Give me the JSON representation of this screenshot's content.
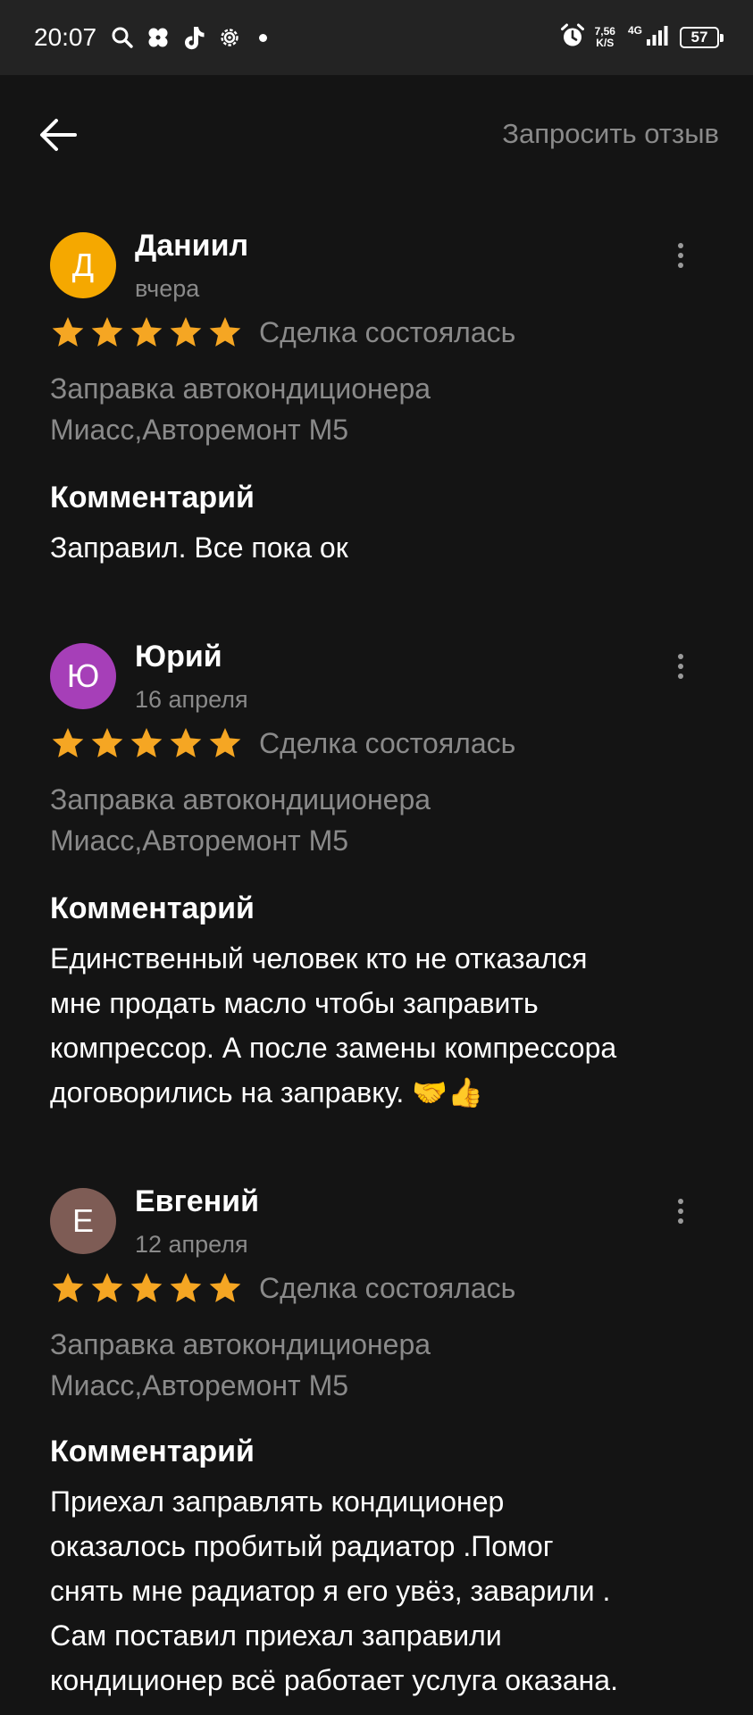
{
  "status_bar": {
    "time": "20:07",
    "left_icons": [
      "search-icon",
      "flower-app-icon",
      "tiktok-icon",
      "settings-gear-icon"
    ],
    "speed_value": "7,56",
    "speed_unit": "K/S",
    "network": "4G",
    "battery": "57"
  },
  "header": {
    "back_icon": "arrow-left-icon",
    "request_review": "Запросить отзыв"
  },
  "colors": {
    "background": "#141414",
    "status_bar": "#232323",
    "star": "#F5A623",
    "muted_text": "#8A8A8A",
    "avatar_d": "#F5A800",
    "avatar_yu": "#A63FB8",
    "avatar_e": "#7E5C55"
  },
  "reviews": [
    {
      "initial": "Д",
      "author": "Даниил",
      "date": "вчера",
      "rating": 5,
      "deal_status": "Сделка состоялась",
      "service_line1": "Заправка автокондиционера",
      "service_line2": "Миасс,Авторемонт М5",
      "comment_heading": "Комментарий",
      "comment": "Заправил. Все пока ок"
    },
    {
      "initial": "Ю",
      "author": "Юрий",
      "date": "16 апреля",
      "rating": 5,
      "deal_status": "Сделка состоялась",
      "service_line1": "Заправка автокондиционера",
      "service_line2": "Миасс,Авторемонт М5",
      "comment_heading": "Комментарий",
      "comment_lines": [
        "Единственный человек кто не отказался",
        "мне продать масло чтобы заправить",
        "компрессор. А после замены компрессора",
        "договорились на заправку. 🤝👍"
      ]
    },
    {
      "initial": "Е",
      "author": "Евгений",
      "date": "12 апреля",
      "rating": 5,
      "deal_status": "Сделка состоялась",
      "service_line1": "Заправка автокондиционера",
      "service_line2": "Миасс,Авторемонт М5",
      "comment_heading": "Комментарий",
      "comment_lines": [
        "Приехал заправлять кондиционер",
        "оказалось пробитый радиатор .Помог",
        "снять мне радиатор я его увёз, заварили .",
        "Сам поставил приехал заправили",
        "кондиционер всё работает услуга оказана."
      ]
    }
  ]
}
